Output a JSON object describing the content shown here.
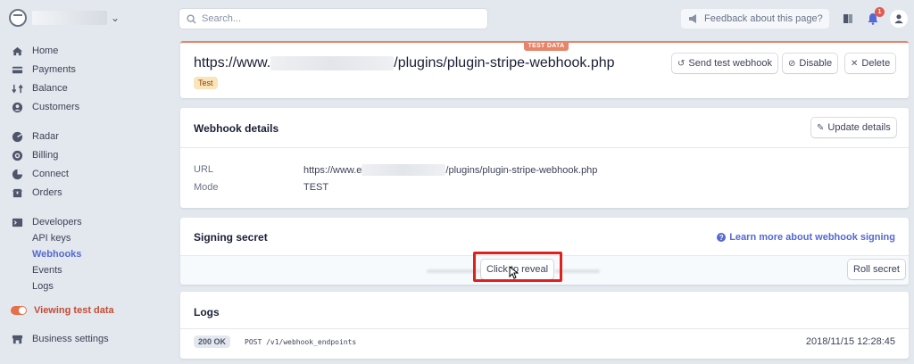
{
  "sidebar": {
    "nav": [
      {
        "label": "Home",
        "icon": "home-icon"
      },
      {
        "label": "Payments",
        "icon": "payments-icon"
      },
      {
        "label": "Balance",
        "icon": "balance-icon"
      },
      {
        "label": "Customers",
        "icon": "customers-icon"
      },
      {
        "label": "Radar",
        "icon": "radar-icon"
      },
      {
        "label": "Billing",
        "icon": "billing-icon"
      },
      {
        "label": "Connect",
        "icon": "connect-icon"
      },
      {
        "label": "Orders",
        "icon": "orders-icon"
      },
      {
        "label": "Developers",
        "icon": "developers-icon"
      }
    ],
    "developers_sub": [
      "API keys",
      "Webhooks",
      "Events",
      "Logs"
    ],
    "active_sub": "Webhooks",
    "test_toggle_label": "Viewing test data",
    "business_settings": "Business settings"
  },
  "topbar": {
    "search_placeholder": "Search...",
    "feedback_label": "Feedback about this page?",
    "notification_count": "1"
  },
  "header": {
    "test_data_tab": "TEST DATA",
    "url_prefix": "https://www.",
    "url_suffix": "/plugins/plugin-stripe-webhook.php",
    "mode_pill": "Test",
    "send_test_label": "Send test webhook",
    "disable_label": "Disable",
    "delete_label": "Delete"
  },
  "details": {
    "title": "Webhook details",
    "update_label": "Update details",
    "url_label": "URL",
    "url_prefix": "https://www.e",
    "url_suffix": "/plugins/plugin-stripe-webhook.php",
    "mode_label": "Mode",
    "mode_value": "TEST"
  },
  "signing": {
    "title": "Signing secret",
    "learn_label": "Learn more about webhook signing",
    "reveal_label": "Click to reveal",
    "roll_label": "Roll secret"
  },
  "logs": {
    "title": "Logs",
    "rows": [
      {
        "status": "200 OK",
        "path": "POST /v1/webhook_endpoints",
        "time": "2018/11/15 12:28:45"
      }
    ]
  },
  "colors": {
    "accent": "#5469d4",
    "test_orange": "#e6856a",
    "highlight_red": "#e0201c"
  }
}
